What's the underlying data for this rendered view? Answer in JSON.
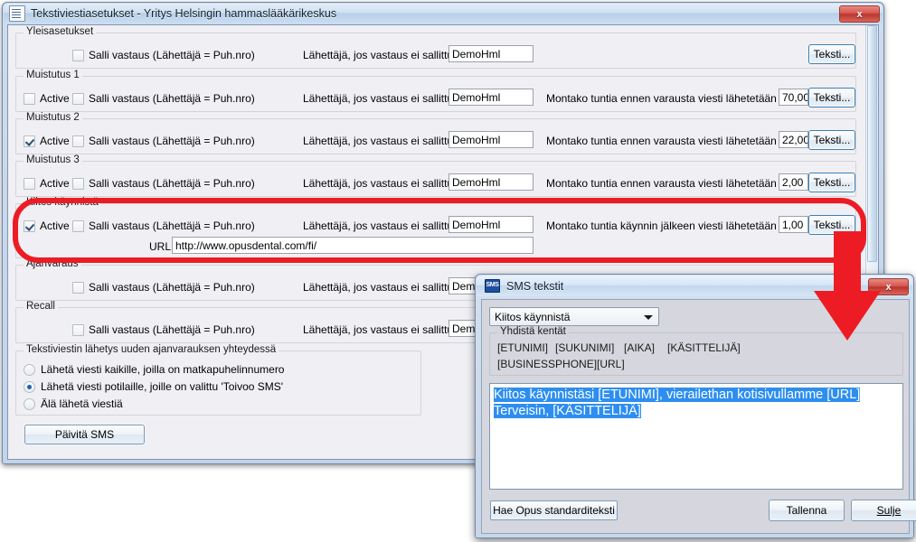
{
  "main_window": {
    "title": "Tekstiviestiasetukset - Yritys Helsingin hammaslääkärikeskus",
    "icon": "document-icon",
    "close_label": "x",
    "common_labels": {
      "active": "Active",
      "allow_reply": "Salli vastaus (Lähettäjä = Puh.nro)",
      "sender_if_no_reply": "Lähettäjä, jos vastaus ei sallittu",
      "hours_before": "Montako tuntia ennen varausta viesti lähetetään",
      "hours_after": "Montako tuntia käynnin jälkeen viesti lähetetään",
      "text_button": "Teksti...",
      "url_label": "URL"
    },
    "sections": [
      {
        "legend": "Yleisasetukset",
        "has_active": false,
        "active_checked": false,
        "allow_reply_checked": false,
        "sender_value": "DemoHml",
        "hours_label": "",
        "hours_value": "",
        "has_text_button": true
      },
      {
        "legend": "Muistutus 1",
        "has_active": true,
        "active_checked": false,
        "allow_reply_checked": false,
        "sender_value": "DemoHml",
        "hours_label": "Montako tuntia ennen varausta viesti lähetetään",
        "hours_value": "70,00",
        "has_text_button": true
      },
      {
        "legend": "Muistutus 2",
        "has_active": true,
        "active_checked": true,
        "allow_reply_checked": false,
        "sender_value": "DemoHml",
        "hours_label": "Montako tuntia ennen varausta viesti lähetetään",
        "hours_value": "22,00",
        "has_text_button": true
      },
      {
        "legend": "Muistutus 3",
        "has_active": true,
        "active_checked": false,
        "allow_reply_checked": false,
        "sender_value": "DemoHml",
        "hours_label": "Montako tuntia ennen varausta viesti lähetetään",
        "hours_value": "2,00",
        "has_text_button": true
      },
      {
        "legend": "Kiitos käynnistä",
        "has_active": true,
        "active_checked": true,
        "allow_reply_checked": false,
        "sender_value": "DemoHml",
        "hours_label": "Montako tuntia käynnin jälkeen viesti lähetetään",
        "hours_value": "1,00",
        "has_text_button": true,
        "url_value": "http://www.opusdental.com/fi/"
      },
      {
        "legend": "Ajanvaraus",
        "has_active": false,
        "active_checked": false,
        "allow_reply_checked": false,
        "sender_value": "DemoHml",
        "hours_label": "",
        "hours_value": "",
        "has_text_button": true
      },
      {
        "legend": "Recall",
        "has_active": false,
        "active_checked": false,
        "allow_reply_checked": false,
        "sender_value": "DemoHml",
        "hours_label": "",
        "hours_value": "",
        "has_text_button": true
      }
    ],
    "send_group": {
      "legend": "Tekstiviestin lähetys uuden ajanvarauksen yhteydessä",
      "options": [
        {
          "label": "Lähetä viesti kaikille, joilla on matkapuhelinnumero",
          "selected": false
        },
        {
          "label": "Lähetä viesti potilaille, joille on valittu 'Toivoo SMS'",
          "selected": true
        },
        {
          "label": "Älä lähetä viestiä",
          "selected": false
        }
      ]
    },
    "update_button": "Päivitä SMS"
  },
  "sms_dialog": {
    "title": "SMS tekstit",
    "icon": "sms-icon",
    "icon_text": "SMS",
    "close_label": "x",
    "template_select": {
      "value": "Kiitos käynnistä"
    },
    "merge_fields": {
      "legend": "Yhdistä kentät",
      "row1": [
        "[ETUNIMI]",
        "[SUKUNIMI]",
        "[AIKA]",
        "[KÄSITTELIJÄ]"
      ],
      "row2": [
        "[BUSINESSPHONE]",
        "[URL]"
      ]
    },
    "message_text": "Kiitos käynnistäsi [ETUNIMI], vierailethan kotisivullamme [URL] Terveisin, [KÄSITTELIJÄ]",
    "buttons": {
      "standard_text": "Hae Opus standarditeksti",
      "save": "Tallenna",
      "close": "Sulje"
    }
  },
  "annotations": {
    "highlight_color": "#ed1c24",
    "arrow_color": "#ed1c24",
    "highlight_target": "Kiitos käynnistä",
    "arrow_points_to": "SMS tekstit -dialog"
  }
}
